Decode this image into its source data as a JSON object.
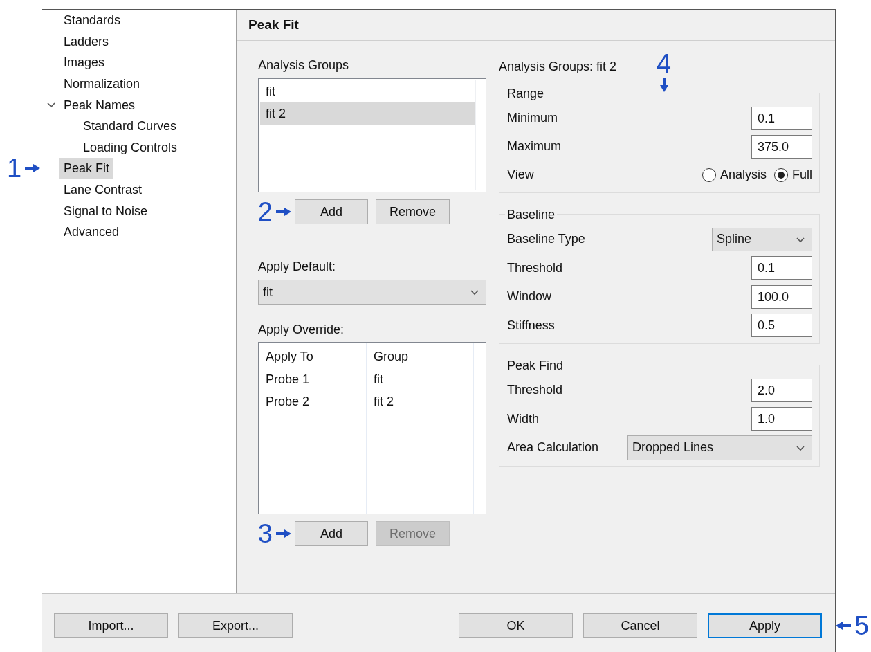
{
  "sidebar": {
    "items": [
      {
        "label": "Standards",
        "selected": false
      },
      {
        "label": "Ladders",
        "selected": false
      },
      {
        "label": "Images",
        "selected": false
      },
      {
        "label": "Normalization",
        "selected": false
      },
      {
        "label": "Peak Names",
        "selected": false,
        "expanded": true,
        "children": [
          {
            "label": "Standard Curves",
            "selected": false
          },
          {
            "label": "Loading Controls",
            "selected": false
          }
        ]
      },
      {
        "label": "Peak Fit",
        "selected": true,
        "callout": "1"
      },
      {
        "label": "Lane Contrast",
        "selected": false
      },
      {
        "label": "Signal to Noise",
        "selected": false
      },
      {
        "label": "Advanced",
        "selected": false
      }
    ]
  },
  "panel": {
    "title": "Peak Fit",
    "analysis_groups": {
      "label": "Analysis Groups",
      "items": [
        {
          "label": "fit",
          "selected": false
        },
        {
          "label": "fit 2",
          "selected": true
        }
      ],
      "buttons": [
        {
          "label": "Add",
          "disabled": false,
          "callout": "2"
        },
        {
          "label": "Remove",
          "disabled": false
        }
      ]
    },
    "apply_default": {
      "label": "Apply Default:",
      "value": "fit"
    },
    "apply_override": {
      "label": "Apply Override:",
      "columns": [
        "Apply To",
        "Group"
      ],
      "rows": [
        [
          "Probe 1",
          "fit"
        ],
        [
          "Probe 2",
          "fit 2"
        ]
      ],
      "buttons": [
        {
          "label": "Add",
          "disabled": false,
          "callout": "3"
        },
        {
          "label": "Remove",
          "disabled": true
        }
      ]
    },
    "settings": {
      "title": "Analysis Groups: fit 2",
      "groups": [
        {
          "title": "Range",
          "callout": "4",
          "rows": [
            {
              "kind": "input",
              "label": "Minimum",
              "value": "0.1"
            },
            {
              "kind": "input",
              "label": "Maximum",
              "value": "375.0"
            },
            {
              "kind": "radio",
              "label": "View",
              "options": [
                {
                  "label": "Analysis",
                  "selected": false
                },
                {
                  "label": "Full",
                  "selected": true
                }
              ]
            }
          ]
        },
        {
          "title": "Baseline",
          "rows": [
            {
              "kind": "dropdown",
              "label": "Baseline Type",
              "value": "Spline"
            },
            {
              "kind": "input",
              "label": "Threshold",
              "value": "0.1"
            },
            {
              "kind": "input",
              "label": "Window",
              "value": "100.0"
            },
            {
              "kind": "input",
              "label": "Stiffness",
              "value": "0.5"
            }
          ]
        },
        {
          "title": "Peak Find",
          "rows": [
            {
              "kind": "input",
              "label": "Threshold",
              "value": "2.0"
            },
            {
              "kind": "input",
              "label": "Width",
              "value": "1.0"
            },
            {
              "kind": "dropdown",
              "label": "Area Calculation",
              "value": "Dropped Lines",
              "wide": true
            }
          ]
        }
      ]
    }
  },
  "footer": {
    "left_buttons": [
      {
        "label": "Import...",
        "default": false
      },
      {
        "label": "Export...",
        "default": false
      }
    ],
    "right_buttons": [
      {
        "label": "OK",
        "default": false
      },
      {
        "label": "Cancel",
        "default": false
      },
      {
        "label": "Apply",
        "default": true,
        "callout": "5"
      }
    ]
  }
}
